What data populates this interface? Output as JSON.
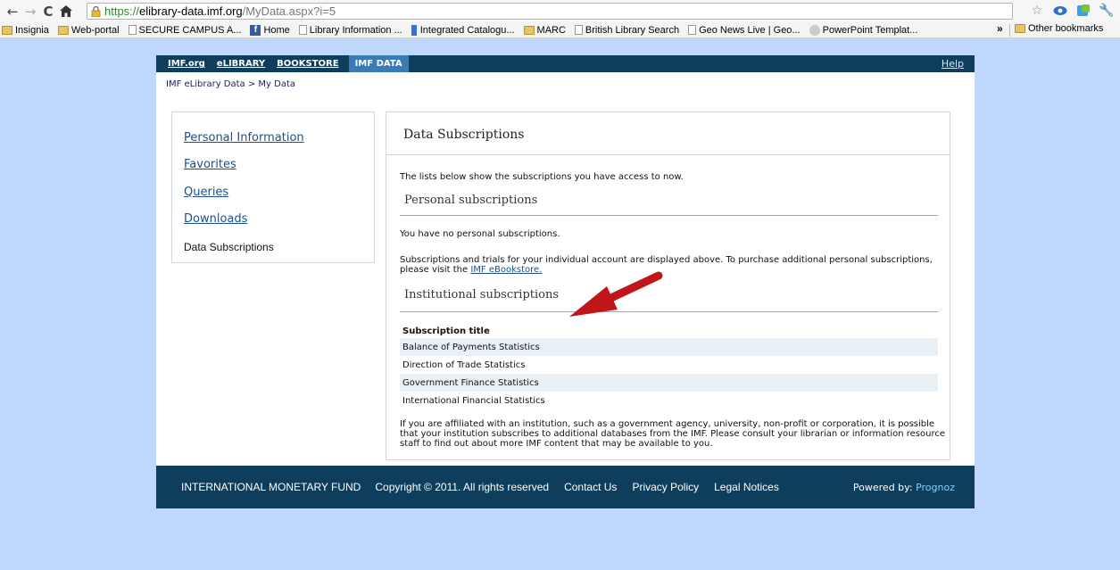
{
  "browser": {
    "url_https": "https://",
    "url_host": "elibrary-data.imf.org",
    "url_path": "/MyData.aspx?i=5",
    "bookmarks": [
      {
        "label": "Insignia",
        "type": "folder"
      },
      {
        "label": "Web-portal",
        "type": "folder"
      },
      {
        "label": "SECURE CAMPUS A...",
        "type": "page"
      },
      {
        "label": "Home",
        "type": "facebook"
      },
      {
        "label": "Library Information ...",
        "type": "page"
      },
      {
        "label": "Integrated Catalogu...",
        "type": "bluebar"
      },
      {
        "label": "MARC",
        "type": "folder"
      },
      {
        "label": "British Library Search",
        "type": "page"
      },
      {
        "label": "Geo News Live | Geo...",
        "type": "page"
      },
      {
        "label": "PowerPoint Templat...",
        "type": "ppt"
      }
    ],
    "overflow": "»",
    "other_bookmarks": "Other bookmarks"
  },
  "topnav": {
    "imf": "IMF.org",
    "elibrary": "eLIBRARY",
    "bookstore": "BOOKSTORE",
    "imfdata": "IMF DATA",
    "help": "Help"
  },
  "breadcrumb": "IMF eLibrary Data > My Data",
  "sidebar": {
    "items": [
      {
        "label": "Personal Information"
      },
      {
        "label": "Favorites"
      },
      {
        "label": "Queries"
      },
      {
        "label": "Downloads"
      },
      {
        "label": "Data Subscriptions"
      }
    ]
  },
  "main": {
    "title": "Data Subscriptions",
    "intro": "The lists below show the subscriptions you have access to now.",
    "personal_title": "Personal subscriptions",
    "personal_none": "You have no personal subscriptions.",
    "personal_note_1": "Subscriptions and trials for your individual account are displayed above. To purchase additional personal subscriptions,",
    "personal_note_2": "please visit the ",
    "bookstore_link": "IMF eBookstore.",
    "institutional_title": "Institutional subscriptions",
    "table_header": "Subscription title",
    "rows": [
      "Balance of Payments Statistics",
      "Direction of Trade Statistics",
      "Government Finance Statistics",
      "International Financial Statistics"
    ],
    "footer_note_1": "If you are affiliated with an institution, such as a government agency, university, non-profit or corporation, it is possible",
    "footer_note_2": "that your institution subscribes to additional databases from the IMF. Please consult your librarian or information resource",
    "footer_note_3": "staff to find out about more IMF content that may be available to you."
  },
  "footer": {
    "org": "INTERNATIONAL MONETARY FUND",
    "copyright": "Copyright © 2011. All rights reserved",
    "contact": "Contact Us",
    "privacy": "Privacy Policy",
    "legal": "Legal Notices",
    "powered": "Powered by: ",
    "prognoz": "Prognoz"
  },
  "colors": {
    "nav_bg": "#0f3e5c",
    "nav_active": "#3a7bb5",
    "page_bg": "#bfd7fa",
    "arrow": "#c0161a"
  }
}
